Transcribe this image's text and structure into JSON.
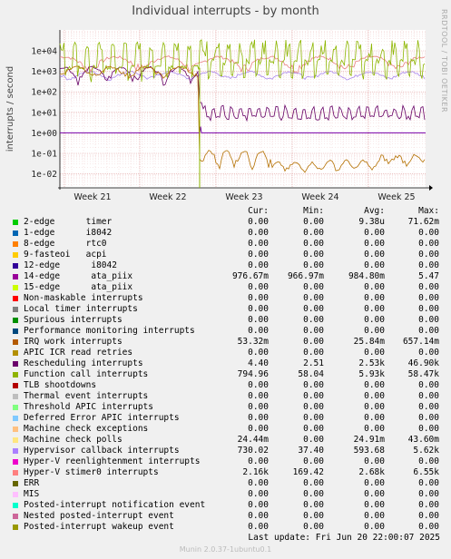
{
  "title": "Individual interrupts - by month",
  "side_label": "RRDTOOL / TOBI OETIKER",
  "chart_data": {
    "type": "line",
    "title": "Individual interrupts - by month",
    "ylabel": "interrupts / second",
    "yscale": "log",
    "ylim": [
      0.005,
      50000
    ],
    "y_ticks": [
      "1e+04",
      "1e+03",
      "1e+02",
      "1e+01",
      "1e+00",
      "1e-01",
      "1e-02"
    ],
    "x_ticks": [
      "Week 21",
      "Week 22",
      "Week 23",
      "Week 24",
      "Week 25"
    ],
    "grid": true,
    "series": [
      {
        "name": "Function call interrupts",
        "color": "#8db600",
        "approx_level_before": "~1e+04 spikes, ~1e+03 base",
        "approx_level_after": "1e+03 to 4e+04"
      },
      {
        "name": "Hyper-V stimer0 interrupts",
        "color": "#cc3366",
        "approx_level": "~2e+03 to 6e+03"
      },
      {
        "name": "IRQ work interrupts",
        "color": "#b48200",
        "approx_level_before": "~1e+03",
        "approx_level_after": "1e-02 to 1e-01"
      },
      {
        "name": "Rescheduling interrupts",
        "color": "#660066",
        "approx_level_before": "~1e+03",
        "approx_level_after": "~5 to 20"
      },
      {
        "name": "14-edge ata_piix",
        "color": "#7700aa",
        "approx_level": "~1e+00"
      },
      {
        "name": "Hypervisor callback interrupts",
        "color": "#8866dd",
        "approx_level": "~6e+02"
      }
    ]
  },
  "legend": {
    "headers": {
      "cur": "Cur:",
      "min": "Min:",
      "avg": "Avg:",
      "max": "Max:"
    },
    "rows": [
      {
        "label": "2-edge      timer",
        "color": "#00cc00",
        "cur": "0.00",
        "min": "0.00",
        "avg": "9.38u",
        "max": "71.62m"
      },
      {
        "label": "1-edge      i8042",
        "color": "#0066b3",
        "cur": "0.00",
        "min": "0.00",
        "avg": "0.00",
        "max": "0.00"
      },
      {
        "label": "8-edge      rtc0",
        "color": "#ff8000",
        "cur": "0.00",
        "min": "0.00",
        "avg": "0.00",
        "max": "0.00"
      },
      {
        "label": "9-fasteoi   acpi",
        "color": "#ffcc00",
        "cur": "0.00",
        "min": "0.00",
        "avg": "0.00",
        "max": "0.00"
      },
      {
        "label": "12-edge      i8042",
        "color": "#330099",
        "cur": "0.00",
        "min": "0.00",
        "avg": "0.00",
        "max": "0.00"
      },
      {
        "label": "14-edge      ata_piix",
        "color": "#990099",
        "cur": "976.67m",
        "min": "966.97m",
        "avg": "984.80m",
        "max": "5.47"
      },
      {
        "label": "15-edge      ata_piix",
        "color": "#ccff00",
        "cur": "0.00",
        "min": "0.00",
        "avg": "0.00",
        "max": "0.00"
      },
      {
        "label": "Non-maskable interrupts",
        "color": "#ff0000",
        "cur": "0.00",
        "min": "0.00",
        "avg": "0.00",
        "max": "0.00"
      },
      {
        "label": "Local timer interrupts",
        "color": "#808080",
        "cur": "0.00",
        "min": "0.00",
        "avg": "0.00",
        "max": "0.00"
      },
      {
        "label": "Spurious interrupts",
        "color": "#008f00",
        "cur": "0.00",
        "min": "0.00",
        "avg": "0.00",
        "max": "0.00"
      },
      {
        "label": "Performance monitoring interrupts",
        "color": "#00487d",
        "cur": "0.00",
        "min": "0.00",
        "avg": "0.00",
        "max": "0.00"
      },
      {
        "label": "IRQ work interrupts",
        "color": "#b35a00",
        "cur": "53.32m",
        "min": "0.00",
        "avg": "25.84m",
        "max": "657.14m"
      },
      {
        "label": "APIC ICR read retries",
        "color": "#b38f00",
        "cur": "0.00",
        "min": "0.00",
        "avg": "0.00",
        "max": "0.00"
      },
      {
        "label": "Rescheduling interrupts",
        "color": "#6b006b",
        "cur": "4.40",
        "min": "2.51",
        "avg": "2.53k",
        "max": "46.90k"
      },
      {
        "label": "Function call interrupts",
        "color": "#8fb300",
        "cur": "794.96",
        "min": "58.04",
        "avg": "5.93k",
        "max": "58.47k"
      },
      {
        "label": "TLB shootdowns",
        "color": "#b30000",
        "cur": "0.00",
        "min": "0.00",
        "avg": "0.00",
        "max": "0.00"
      },
      {
        "label": "Thermal event interrupts",
        "color": "#bebebe",
        "cur": "0.00",
        "min": "0.00",
        "avg": "0.00",
        "max": "0.00"
      },
      {
        "label": "Threshold APIC interrupts",
        "color": "#80ff80",
        "cur": "0.00",
        "min": "0.00",
        "avg": "0.00",
        "max": "0.00"
      },
      {
        "label": "Deferred Error APIC interrupts",
        "color": "#80c9ff",
        "cur": "0.00",
        "min": "0.00",
        "avg": "0.00",
        "max": "0.00"
      },
      {
        "label": "Machine check exceptions",
        "color": "#ffc080",
        "cur": "0.00",
        "min": "0.00",
        "avg": "0.00",
        "max": "0.00"
      },
      {
        "label": "Machine check polls",
        "color": "#ffe680",
        "cur": "24.44m",
        "min": "0.00",
        "avg": "24.91m",
        "max": "43.60m"
      },
      {
        "label": "Hypervisor callback interrupts",
        "color": "#aa80ff",
        "cur": "730.02",
        "min": "37.40",
        "avg": "593.68",
        "max": "5.62k"
      },
      {
        "label": "Hyper-V reenlightenment interrupts",
        "color": "#ee00cc",
        "cur": "0.00",
        "min": "0.00",
        "avg": "0.00",
        "max": "0.00"
      },
      {
        "label": "Hyper-V stimer0 interrupts",
        "color": "#ff8080",
        "cur": "2.16k",
        "min": "169.42",
        "avg": "2.68k",
        "max": "6.55k"
      },
      {
        "label": "ERR",
        "color": "#666600",
        "cur": "0.00",
        "min": "0.00",
        "avg": "0.00",
        "max": "0.00"
      },
      {
        "label": "MIS",
        "color": "#ffbfff",
        "cur": "0.00",
        "min": "0.00",
        "avg": "0.00",
        "max": "0.00"
      },
      {
        "label": "Posted-interrupt notification event",
        "color": "#00ffcc",
        "cur": "0.00",
        "min": "0.00",
        "avg": "0.00",
        "max": "0.00"
      },
      {
        "label": "Nested posted-interrupt event",
        "color": "#cc6699",
        "cur": "0.00",
        "min": "0.00",
        "avg": "0.00",
        "max": "0.00"
      },
      {
        "label": "Posted-interrupt wakeup event",
        "color": "#999900",
        "cur": "0.00",
        "min": "0.00",
        "avg": "0.00",
        "max": "0.00"
      }
    ]
  },
  "last_update": "Last update: Fri Jun 20 22:00:07 2025",
  "footer": "Munin 2.0.37-1ubuntu0.1"
}
